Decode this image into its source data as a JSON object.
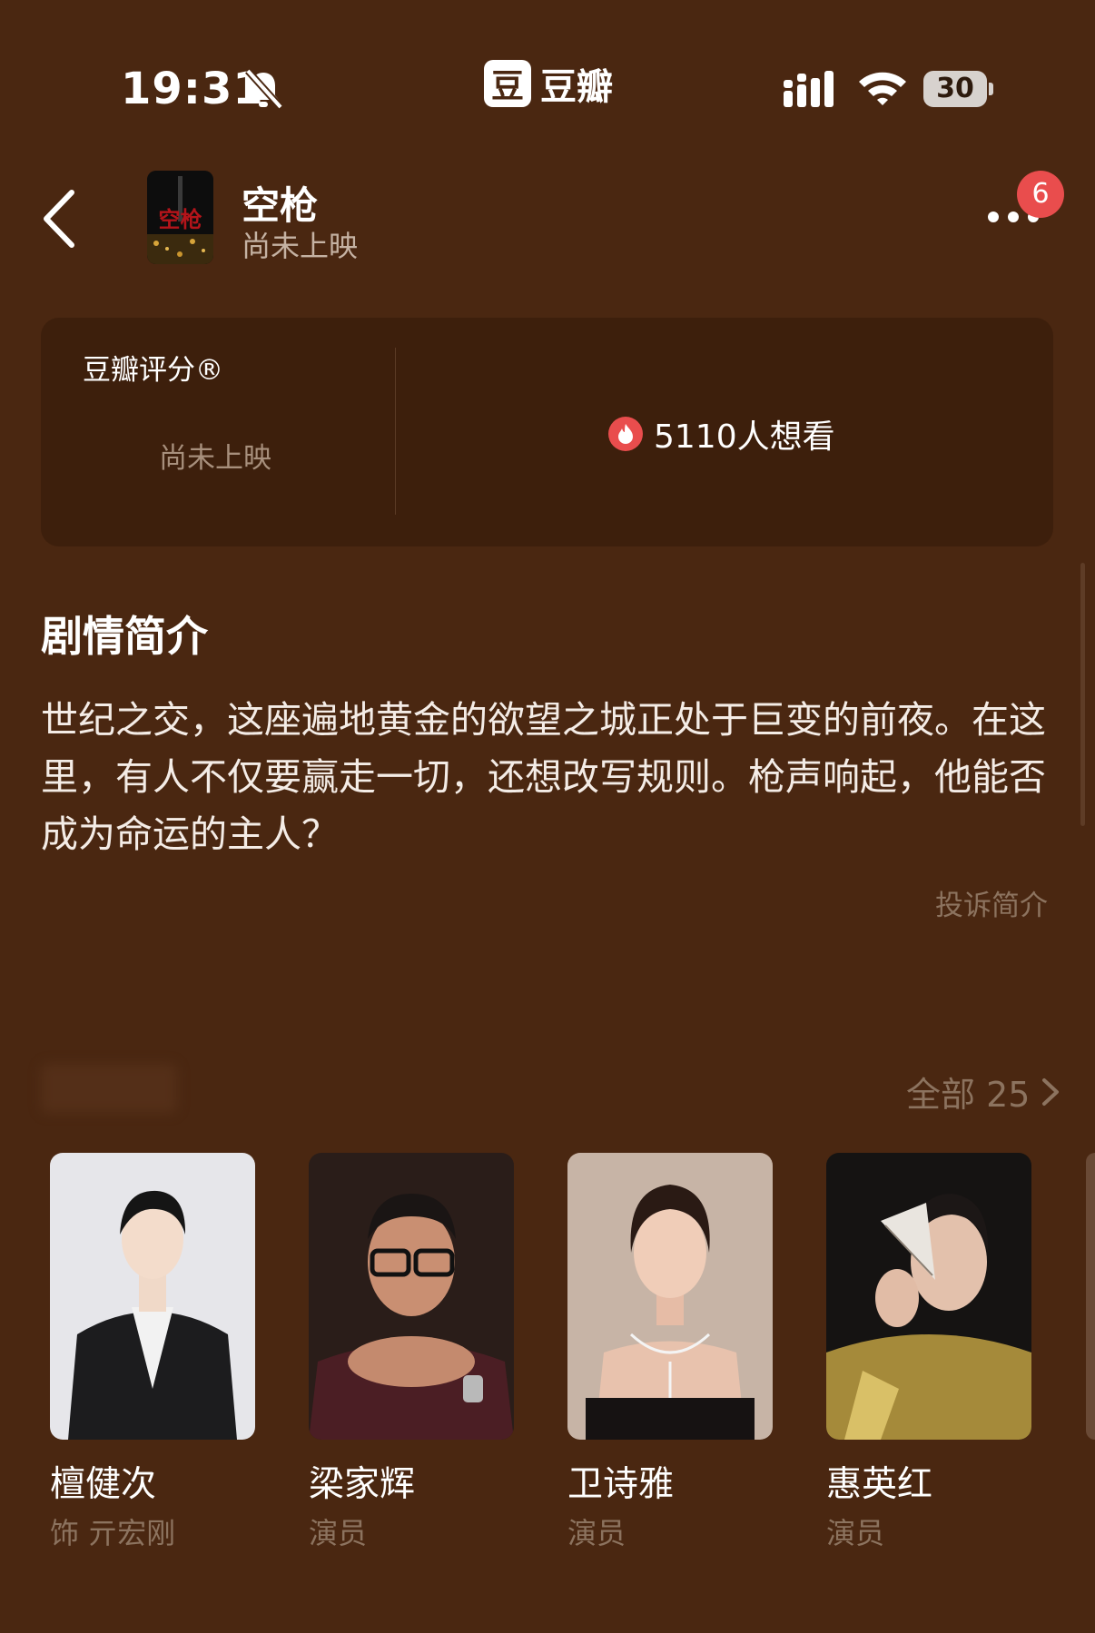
{
  "status_bar": {
    "time": "19:31",
    "battery": "30",
    "app_logo_glyph": "豆",
    "app_name": "豆瓣"
  },
  "nav": {
    "title": "空枪",
    "subtitle": "尚未上映",
    "poster_text": "空枪",
    "badge_count": "6"
  },
  "rating": {
    "label": "豆瓣评分®",
    "status": "尚未上映",
    "wish_text": "5110人想看"
  },
  "synopsis": {
    "heading": "剧情简介",
    "text": "世纪之交，这座遍地黄金的欲望之城正处于巨变的前夜。在这里，有人不仅要赢走一切，还想改写规则。枪声响起，他能否成为命运的主人？",
    "report": "投诉简介"
  },
  "cast": {
    "all_label": "全部 25",
    "members": [
      {
        "name": "檀健次",
        "role": "饰 亓宏刚"
      },
      {
        "name": "梁家辉",
        "role": "演员"
      },
      {
        "name": "卫诗雅",
        "role": "演员"
      },
      {
        "name": "惠英红",
        "role": "演员"
      }
    ]
  },
  "colors": {
    "background": "#4a2711",
    "card": "#3d1f0c",
    "badge": "#e94d4d",
    "muted": "#8c735f"
  },
  "icons": [
    "bell-off-icon",
    "signal-icon",
    "wifi-icon",
    "battery-icon",
    "back-icon",
    "more-icon",
    "fire-icon",
    "chevron-right-icon"
  ]
}
